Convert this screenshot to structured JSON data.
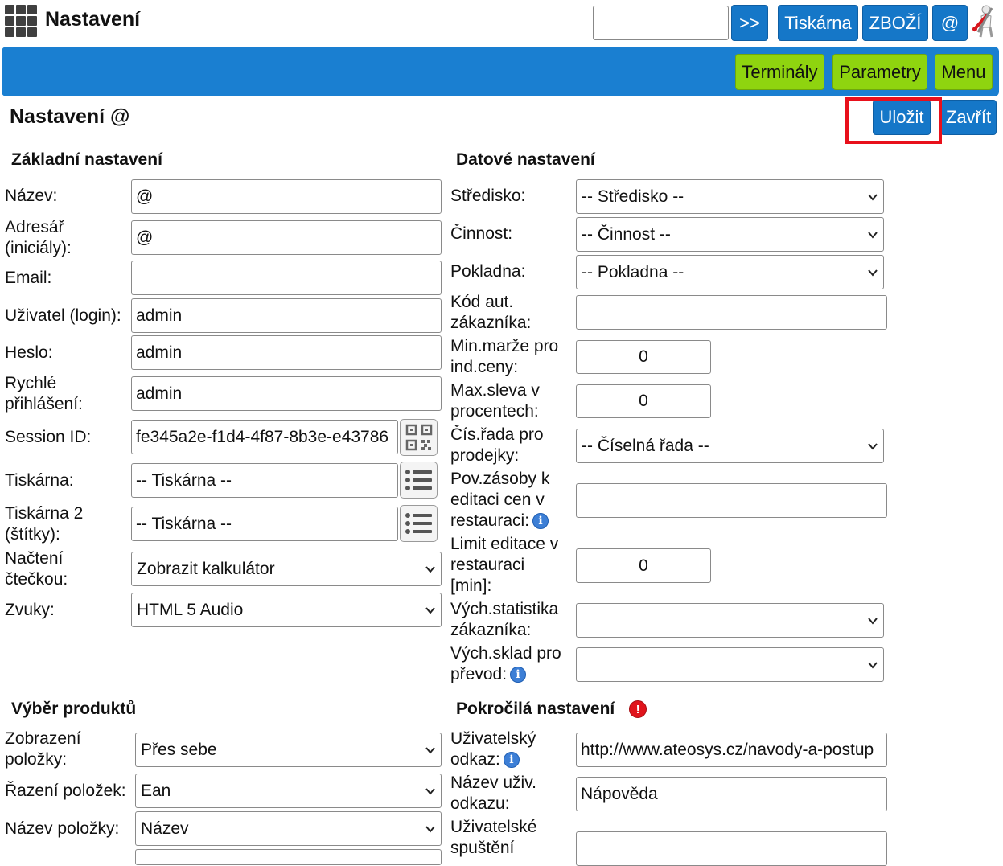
{
  "app": {
    "title": "Nastavení"
  },
  "topbar": {
    "search_value": "",
    "go_label": ">>",
    "printer_label": "Tiskárna",
    "goods_label": "ZBOŽÍ",
    "at_label": "@"
  },
  "band": {
    "terminals_label": "Terminály",
    "params_label": "Parametry",
    "menu_label": "Menu"
  },
  "page": {
    "title": "Nastavení @",
    "save_label": "Uložit",
    "close_label": "Zavřít"
  },
  "basic": {
    "title": "Základní nastavení",
    "name_label": "Název:",
    "name_value": "@",
    "book_label_1": "Adresář",
    "book_label_2": "(iniciály):",
    "book_value": "@",
    "email_label": "Email:",
    "email_value": "",
    "user_label": "Uživatel (login):",
    "user_value": "admin",
    "pass_label": "Heslo:",
    "pass_value": "admin",
    "quick_label_1": "Rychlé",
    "quick_label_2": "přihlášení:",
    "quick_value": "admin",
    "session_label": "Session ID:",
    "session_value": "fe345a2e-f1d4-4f87-8b3e-e43786",
    "printer_label": "Tiskárna:",
    "printer_value": "-- Tiskárna --",
    "printer2_label_1": "Tiskárna 2",
    "printer2_label_2": "(štítky):",
    "printer2_value": "-- Tiskárna --",
    "reader_label_1": "Načtení",
    "reader_label_2": "čtečkou:",
    "reader_value": "Zobrazit kalkulátor",
    "sound_label": "Zvuky:",
    "sound_value": "HTML 5 Audio"
  },
  "data_settings": {
    "title": "Datové nastavení",
    "center_label": "Středisko:",
    "center_value": "-- Středisko --",
    "activity_label": "Činnost:",
    "activity_value": "-- Činnost --",
    "cash_label": "Pokladna:",
    "cash_value": "-- Pokladna --",
    "code_label_1": "Kód aut.",
    "code_label_2": "zákazníka:",
    "code_value": "",
    "minmargin_label_1": "Min.marže pro",
    "minmargin_label_2": "ind.ceny:",
    "minmargin_value": "0",
    "maxdisc_label_1": "Max.sleva v",
    "maxdisc_label_2": "procentech:",
    "maxdisc_value": "0",
    "series_label_1": "Čís.řada pro",
    "series_label_2": "prodejky:",
    "series_value": "-- Číselná řada --",
    "stock_label_1": "Pov.zásoby k",
    "stock_label_2": "editaci cen v",
    "stock_label_3": "restauraci:",
    "stock_value": "",
    "limit_label_1": "Limit editace v",
    "limit_label_2": "restauraci",
    "limit_label_3": "[min]:",
    "limit_value": "0",
    "stat_label_1": "Vých.statistika",
    "stat_label_2": "zákazníka:",
    "stat_value": "",
    "warehouse_label_1": "Vých.sklad pro",
    "warehouse_label_2": "převod:",
    "warehouse_value": ""
  },
  "products": {
    "title": "Výběr produktů",
    "display_label_1": "Zobrazení",
    "display_label_2": "položky:",
    "display_value": "Přes sebe",
    "sort_label": "Řazení položek:",
    "sort_value": "Ean",
    "itemname_label": "Název položky:",
    "itemname_value": "Název"
  },
  "advanced": {
    "title": "Pokročilá nastavení",
    "userlink_label_1": "Uživatelský",
    "userlink_label_2": "odkaz:",
    "userlink_value": "http://www.ateosys.cz/navody-a-postup",
    "linkname_label_1": "Název uživ.",
    "linkname_label_2": "odkazu:",
    "linkname_value": "Nápověda",
    "userrun_label_1": "Uživatelské",
    "userrun_label_2": "spuštění",
    "userrun_value": ""
  }
}
